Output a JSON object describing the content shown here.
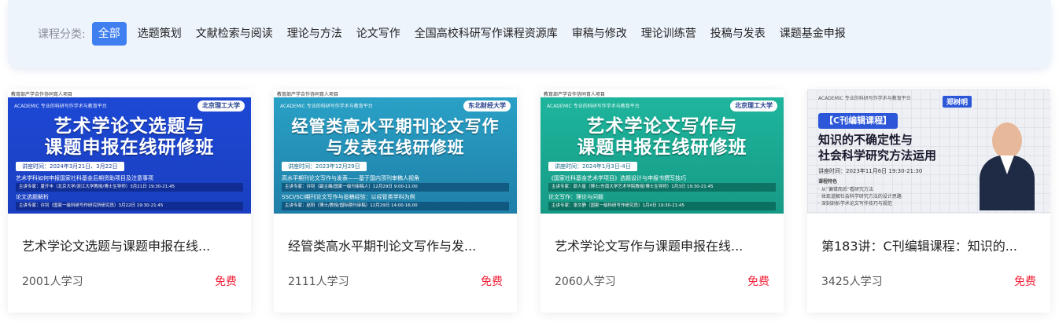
{
  "filter": {
    "label": "课程分类:",
    "items": [
      "全部",
      "选题策划",
      "文献检索与阅读",
      "理论与方法",
      "论文写作",
      "全国高校科研写作课程资源库",
      "审稿与修改",
      "理论训练营",
      "投稿与发表",
      "课题基金申报"
    ],
    "active_index": 0
  },
  "colors": {
    "accent": "#3f7ff0",
    "price": "#f0243a",
    "filter_bg": "#eef4fc"
  },
  "courses": [
    {
      "thumb": {
        "topline": "教育部产学合作协同育人项目",
        "logo_left": "ACADEMIC 专业的科研写作学术与教育平台",
        "logo_right": "北京理工大学",
        "headline1": "艺术学论文选题与",
        "headline2": "课题申报在线研修班",
        "time": "讲座时间：2024年3月21日、3月22日",
        "line1": "艺术学科如何申报国家社科基金后期资助项目及注意事项",
        "bar1": "主讲专家：夏开丰（北京大学/浙江大学教授/博士生导师）3月21日 19:30-21:45",
        "line2": "论文选题解析",
        "bar2": "主讲专家：许钊（国家一级科研写作研究所研究员）3月22日 19:30-21:45"
      },
      "title": "艺术学论文选题与课题申报在线...",
      "learners": "2001人学习",
      "price": "免费"
    },
    {
      "thumb": {
        "topline": "教育部产学合作协同育人项目",
        "logo_left": "ACADEMIC 专业的科研写作学术与教育平台",
        "logo_right": "东北财经大学",
        "headline1": "经管类高水平期刊论文写作",
        "headline2": "与发表在线研修班",
        "time": "讲座时间：2023年12月29日",
        "line1": "高水平期刊论文写作与发表——基于国内顶刊审稿人视角",
        "bar1": "主讲专家：许钊（副主编/国家一级刊审稿人）12月29日 9:00-11:00",
        "line2": "SSCI/SCI期刊论文写作与投稿经验：以经管类学科为例",
        "bar2": "主讲专家：赵阳（博士/教授/国际期刊审稿）12月29日 14:00-16:00"
      },
      "title": "经管类高水平期刊论文写作与发...",
      "learners": "2111人学习",
      "price": "免费"
    },
    {
      "thumb": {
        "topline": "教育部产学合作协同育人项目",
        "logo_left": "ACADEMIC 专业的科研写作学术与教育平台",
        "logo_right": "北京理工大学",
        "headline1": "艺术学论文写作与",
        "headline2": "课题申报在线研修班",
        "time": "讲座时间：2024年1月3日-4日",
        "line1": "《国家社科基金艺术学项目》选题设计与申报书撰写技巧",
        "bar1": "主讲专家：郭人星（博士/东南大学艺术学院教授/博士生导师）1月3日 19:30-21:45",
        "line2": "论文写作：理论与问题",
        "bar2": "主讲专家：张文静（国家一级科研写作研究员）1月4日 19:30-21:45"
      },
      "title": "艺术学论文写作与课题申报在线...",
      "learners": "2060人学习",
      "price": "免费"
    },
    {
      "thumb": {
        "topline": "ACADEMIC 专业的科研写作学术与教育平台",
        "tag": "【C刊编辑课程】",
        "headline1": "知识的不确定性与",
        "headline2": "社会科学研究方法运用",
        "name": "郑树明",
        "time": "讲座时间：2023年11月6日 19:30-21:30",
        "line1": "课程特色",
        "line2": "· 从“偏错而后”看研究方法",
        "line3": "· 体现道解社会科学研究方法的设计思路",
        "line4": "· 深刻剖析学术论文写作技巧与规范"
      },
      "title": "第183讲：C刊编辑课程：知识的...",
      "learners": "3425人学习",
      "price": "免费"
    }
  ]
}
